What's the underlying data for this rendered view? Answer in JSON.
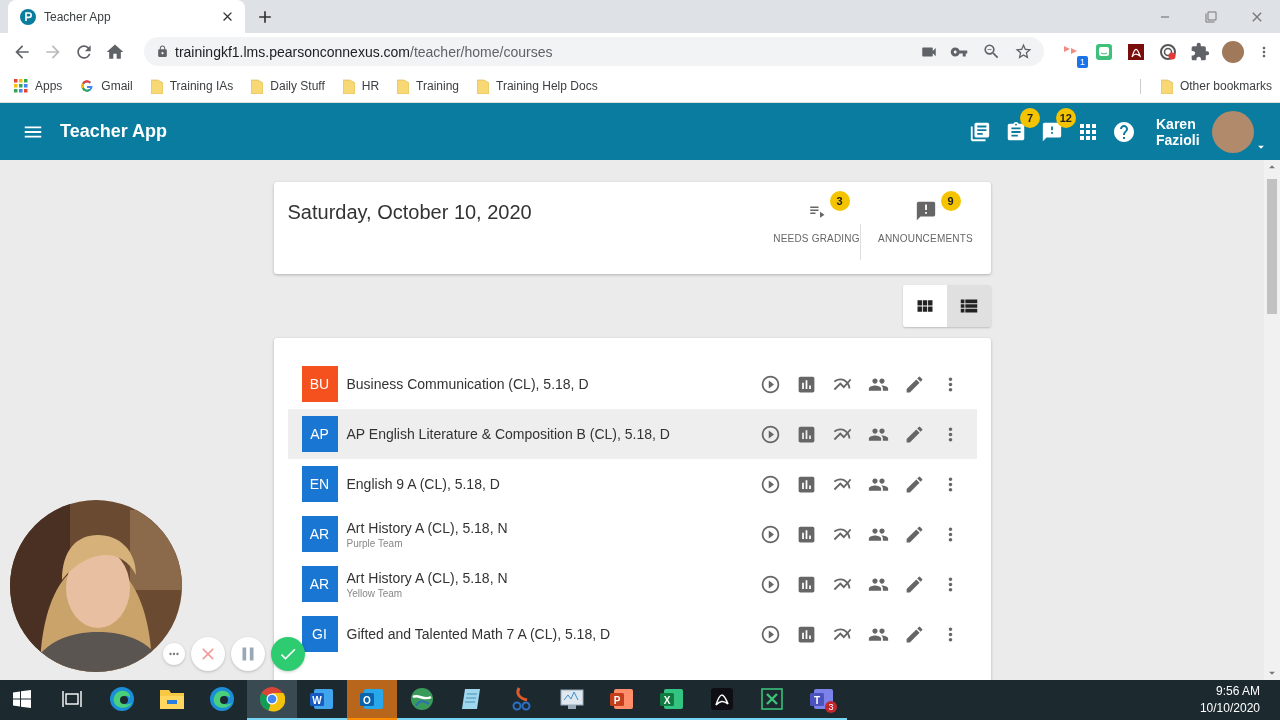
{
  "browser": {
    "tab": {
      "title": "Teacher App"
    },
    "address": {
      "host": "trainingkf1.lms.pearsonconnexus.com",
      "path": "/teacher/home/courses"
    },
    "extensions": [
      {
        "kind": "pinwheel",
        "badge": "1"
      },
      {
        "kind": "bitmoji"
      },
      {
        "kind": "acrobat"
      },
      {
        "kind": "screencast"
      },
      {
        "kind": "puzzle"
      }
    ],
    "bookmarks": [
      {
        "kind": "apps",
        "label": "Apps"
      },
      {
        "kind": "google",
        "label": "Gmail"
      },
      {
        "kind": "folder",
        "label": "Training IAs"
      },
      {
        "kind": "folder",
        "label": "Daily Stuff"
      },
      {
        "kind": "folder",
        "label": "HR"
      },
      {
        "kind": "folder",
        "label": "Training"
      },
      {
        "kind": "folder",
        "label": "Training Help Docs"
      }
    ],
    "other_bookmarks": "Other bookmarks"
  },
  "app_bar": {
    "title": "Teacher App",
    "icons": [
      {
        "kind": "library"
      },
      {
        "kind": "assignment",
        "badge": "7"
      },
      {
        "kind": "feedback",
        "badge": "12"
      },
      {
        "kind": "apps"
      },
      {
        "kind": "help"
      }
    ],
    "user": {
      "first_name": "Karen",
      "last_name": "Fazioli"
    }
  },
  "summary": {
    "date": "Saturday, October 10, 2020",
    "stats": [
      {
        "kind": "grading",
        "badge": "3",
        "label": "NEEDS GRADING"
      },
      {
        "kind": "announcements",
        "badge": "9",
        "label": "ANNOUNCEMENTS"
      }
    ]
  },
  "view_toggle": [
    {
      "kind": "grid",
      "selected": false
    },
    {
      "kind": "list",
      "selected": true
    }
  ],
  "courses": [
    {
      "abbr": "BU",
      "color": "#f4511e",
      "name": "Business Communication (CL), 5.18, D",
      "hovered": false
    },
    {
      "abbr": "AP",
      "color": "#1976d2",
      "name": "AP English Literature & Composition B (CL), 5.18, D",
      "hovered": true
    },
    {
      "abbr": "EN",
      "color": "#1976d2",
      "name": "English 9 A (CL), 5.18, D",
      "hovered": false
    },
    {
      "abbr": "AR",
      "color": "#1976d2",
      "name": "Art History A (CL), 5.18, N",
      "subtitle": "Purple Team",
      "hovered": false
    },
    {
      "abbr": "AR",
      "color": "#1976d2",
      "name": "Art History A (CL), 5.18, N",
      "subtitle": "Yellow Team",
      "hovered": false
    },
    {
      "abbr": "GI",
      "color": "#1976d2",
      "name": "Gifted and Talented Math 7 A (CL), 5.18, D",
      "hovered": false
    }
  ],
  "recorder": {
    "controls": [
      {
        "kind": "more"
      },
      {
        "kind": "cancel"
      },
      {
        "kind": "pause"
      },
      {
        "kind": "done"
      }
    ]
  },
  "taskbar": {
    "apps": [
      {
        "kind": "start",
        "running": false,
        "selected": false,
        "attention": false
      },
      {
        "kind": "taskview",
        "running": false,
        "selected": false,
        "attention": false
      },
      {
        "kind": "edge",
        "running": false,
        "selected": false,
        "attention": false
      },
      {
        "kind": "explorer",
        "running": false,
        "selected": false,
        "attention": false
      },
      {
        "kind": "edge",
        "running": false,
        "selected": false,
        "attention": false
      },
      {
        "kind": "chrome",
        "running": true,
        "selected": true,
        "attention": false
      },
      {
        "kind": "word",
        "letter": "W",
        "running": true,
        "selected": false,
        "attention": false
      },
      {
        "kind": "outlook",
        "letter": "O",
        "running": true,
        "selected": false,
        "attention": true
      },
      {
        "kind": "globe",
        "running": true,
        "selected": false,
        "attention": false
      },
      {
        "kind": "notepad",
        "running": true,
        "selected": false,
        "attention": false
      },
      {
        "kind": "snip",
        "running": true,
        "selected": false,
        "attention": false
      },
      {
        "kind": "monitor",
        "running": true,
        "selected": false,
        "attention": false
      },
      {
        "kind": "powerpoint",
        "letter": "P",
        "running": true,
        "selected": false,
        "attention": false
      },
      {
        "kind": "excel",
        "letter": "X",
        "running": true,
        "selected": false,
        "attention": false
      },
      {
        "kind": "acrobat",
        "running": true,
        "selected": false,
        "attention": false
      },
      {
        "kind": "mindmap",
        "running": true,
        "selected": false,
        "attention": false
      },
      {
        "kind": "teams",
        "letter": "T",
        "badge": "3",
        "running": true,
        "selected": false,
        "attention": false
      }
    ],
    "time": "9:56 AM",
    "date": "10/10/2020"
  }
}
